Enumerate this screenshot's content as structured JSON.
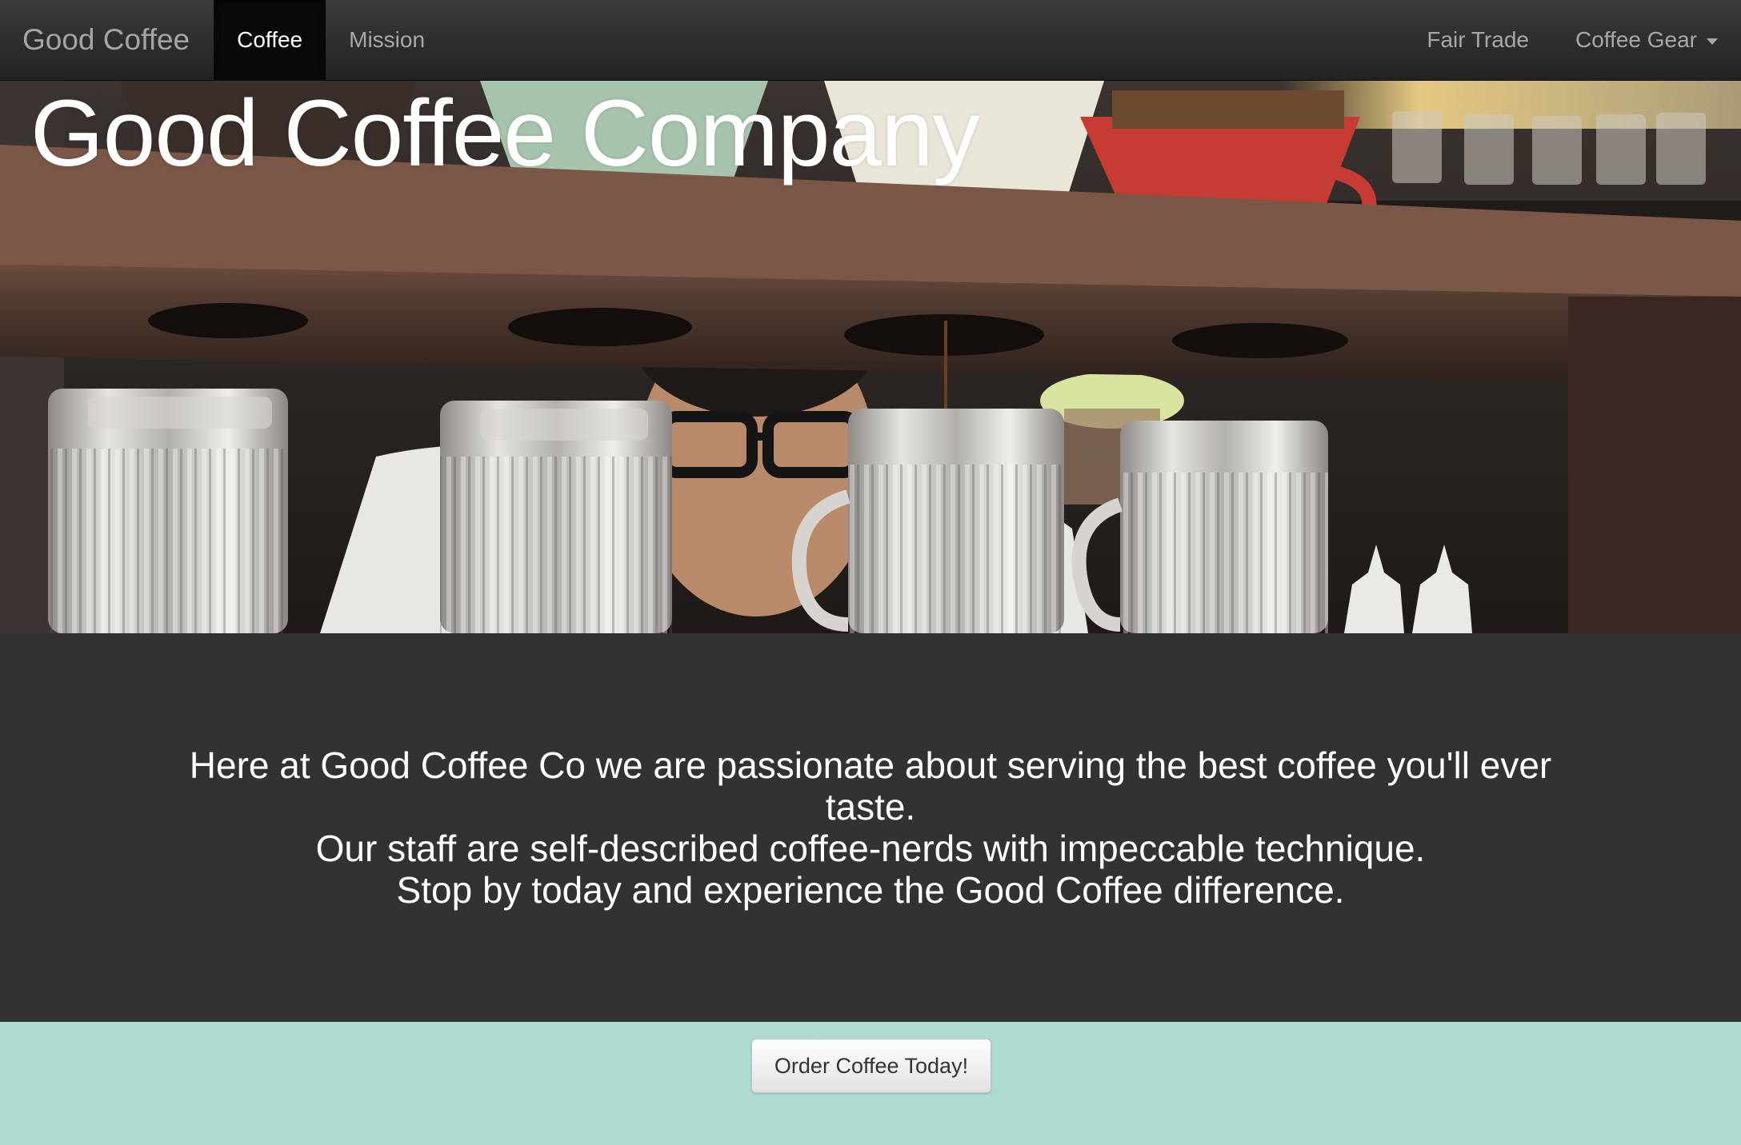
{
  "navbar": {
    "brand": "Good Coffee",
    "left_links": [
      {
        "label": "Coffee",
        "active": true
      },
      {
        "label": "Mission",
        "active": false
      }
    ],
    "right_links": [
      {
        "label": "Fair Trade"
      },
      {
        "label": "Coffee Gear",
        "dropdown": true
      }
    ]
  },
  "hero": {
    "title": "Good Coffee Company",
    "image_subject": "barista-pour-over-coffee-bar-photo"
  },
  "intro": {
    "lines": [
      "Here at Good Coffee Co we are passionate about serving the best coffee you'll ever taste.",
      "Our staff are self-described coffee-nerds with impeccable technique.",
      "Stop by today and experience the Good Coffee difference."
    ]
  },
  "cta": {
    "button_label": "Order Coffee Today!"
  },
  "colors": {
    "navbar_bg": "#2a2a2a",
    "intro_bg": "#323232",
    "cta_bg": "#acdbd0"
  }
}
